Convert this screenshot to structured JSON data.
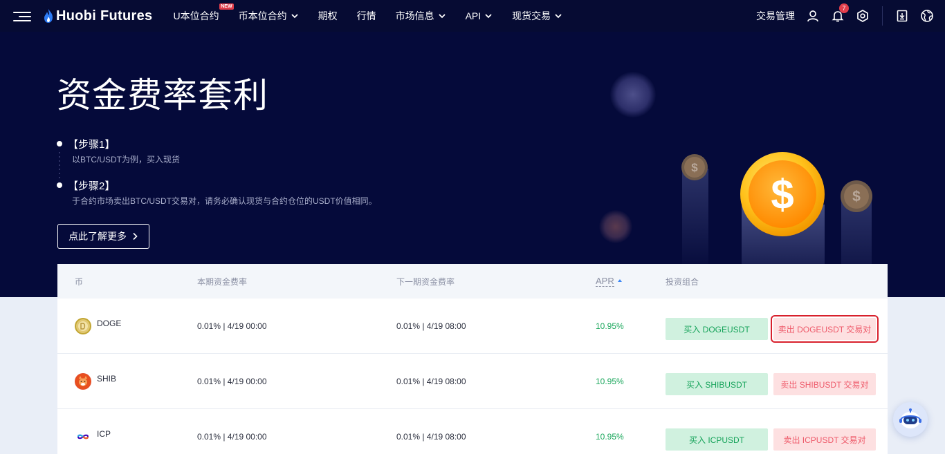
{
  "nav": {
    "logo_text": "Huobi Futures",
    "items": [
      {
        "label": "U本位合约",
        "badge": "NEW",
        "has_chevron": false
      },
      {
        "label": "币本位合约",
        "badge": "",
        "has_chevron": true
      },
      {
        "label": "期权",
        "badge": "",
        "has_chevron": false
      },
      {
        "label": "行情",
        "badge": "",
        "has_chevron": false
      },
      {
        "label": "市场信息",
        "badge": "",
        "has_chevron": true
      },
      {
        "label": "API",
        "badge": "",
        "has_chevron": true
      },
      {
        "label": "现货交易",
        "badge": "",
        "has_chevron": true
      }
    ],
    "trade_mgmt": "交易管理",
    "notification_count": "7"
  },
  "hero": {
    "title": "资金费率套利",
    "step1_title": "【步骤1】",
    "step1_desc": "以BTC/USDT为例，买入现货",
    "step2_title": "【步骤2】",
    "step2_desc": "于合约市场卖出BTC/USDT交易对，请务必确认现货与合约仓位的USDT价值相同。",
    "learn_more": "点此了解更多",
    "coin_symbol": "$"
  },
  "table": {
    "headers": {
      "coin": "币",
      "current_rate": "本期资金费率",
      "next_rate": "下一期资金费率",
      "apr": "APR",
      "portfolio": "投资组合"
    },
    "rows": [
      {
        "coin": "DOGE",
        "current": "0.01% | 4/19 00:00",
        "next": "0.01% | 4/19 08:00",
        "apr": "10.95%",
        "buy": "买入 DOGEUSDT",
        "sell": "卖出 DOGEUSDT 交易对"
      },
      {
        "coin": "SHIB",
        "current": "0.01% | 4/19 00:00",
        "next": "0.01% | 4/19 08:00",
        "apr": "10.95%",
        "buy": "买入 SHIBUSDT",
        "sell": "卖出 SHIBUSDT 交易对"
      },
      {
        "coin": "ICP",
        "current": "0.01% | 4/19 00:00",
        "next": "0.01% | 4/19 08:00",
        "apr": "10.95%",
        "buy": "买入 ICPUSDT",
        "sell": "卖出 ICPUSDT 交易对"
      }
    ]
  },
  "colors": {
    "nav_bg": "#060b33",
    "hero_bg": "#050a3a",
    "buy_bg": "#d0f1df",
    "buy_text": "#16a35a",
    "sell_bg": "#fde0e1",
    "sell_text": "#ee5a6a",
    "highlight": "#d8202c",
    "apr_text": "#18a65a"
  },
  "icons": [
    "menu-icon",
    "user-icon",
    "bell-icon",
    "settings-icon",
    "download-icon",
    "globe-icon",
    "dollar-coin-icon",
    "doge-icon",
    "shib-icon",
    "icp-icon",
    "robot-assistant-icon"
  ]
}
